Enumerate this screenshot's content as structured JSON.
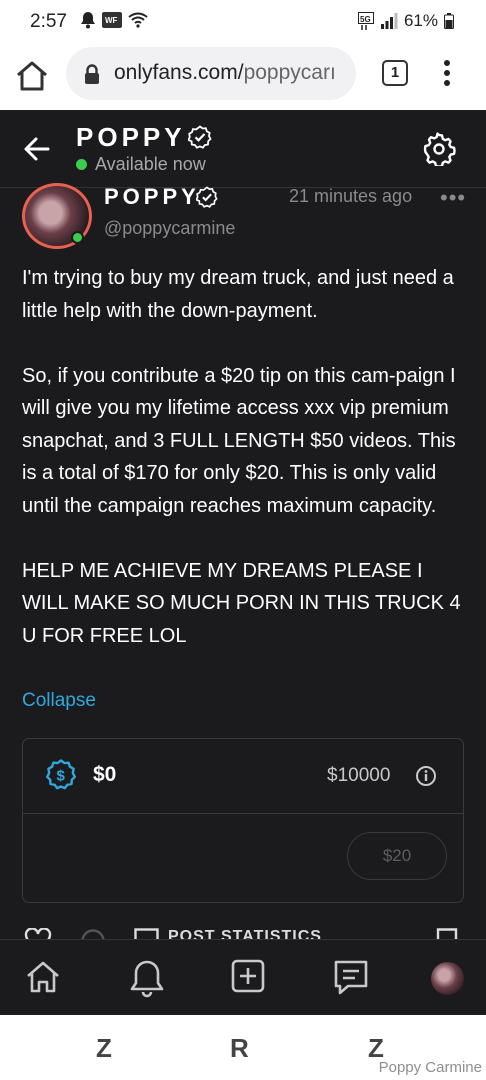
{
  "status_bar": {
    "time": "2:57",
    "left_icons": [
      "alarm-icon",
      "wf-app-icon",
      "wifi-icon"
    ],
    "right_icons": [
      "5g-icon",
      "signal-icon"
    ],
    "battery": "61%"
  },
  "browser": {
    "url_domain": "onlyfans.com/",
    "url_path": "poppycarı",
    "tab_count": "1"
  },
  "chat_header": {
    "name": "POPPY",
    "presence": "Available now"
  },
  "post": {
    "author_name": "POPPY",
    "time_ago": "21 minutes ago",
    "handle": "@poppycarmine",
    "more_label": "•••",
    "paragraphs": [
      "I'm trying to buy my dream truck, and just need a little help with the down-payment.",
      "So, if you contribute a $20 tip on this cam-paign I will give you my lifetime access xxx vip premium snapchat, and 3 FULL LENGTH $50 videos. This is a total of $170 for only $20. This is only valid until the campaign reaches maximum capacity.",
      "HELP ME ACHIEVE MY DREAMS PLEASE I WILL MAKE SO MUCH PORN IN THIS TRUCK 4 U FOR FREE LOL"
    ],
    "collapse_label": "Collapse"
  },
  "tip_campaign": {
    "current_amount": "$0",
    "goal_amount": "$10000",
    "tip_button_label": "$20"
  },
  "post_actions": {
    "stats_label": "POST STATISTICS"
  },
  "bottom_nav": [
    "home-icon",
    "notifications-icon",
    "add-post-icon",
    "messages-icon",
    "profile-avatar"
  ],
  "system_nav": {
    "left": "Z",
    "center": "R",
    "right": "Z"
  },
  "watermark": "Poppy Carmine",
  "colors": {
    "background": "#1b1b1d",
    "link": "#2fa8e0",
    "online": "#3bcd4f",
    "avatar_ring": "#e8624f"
  }
}
